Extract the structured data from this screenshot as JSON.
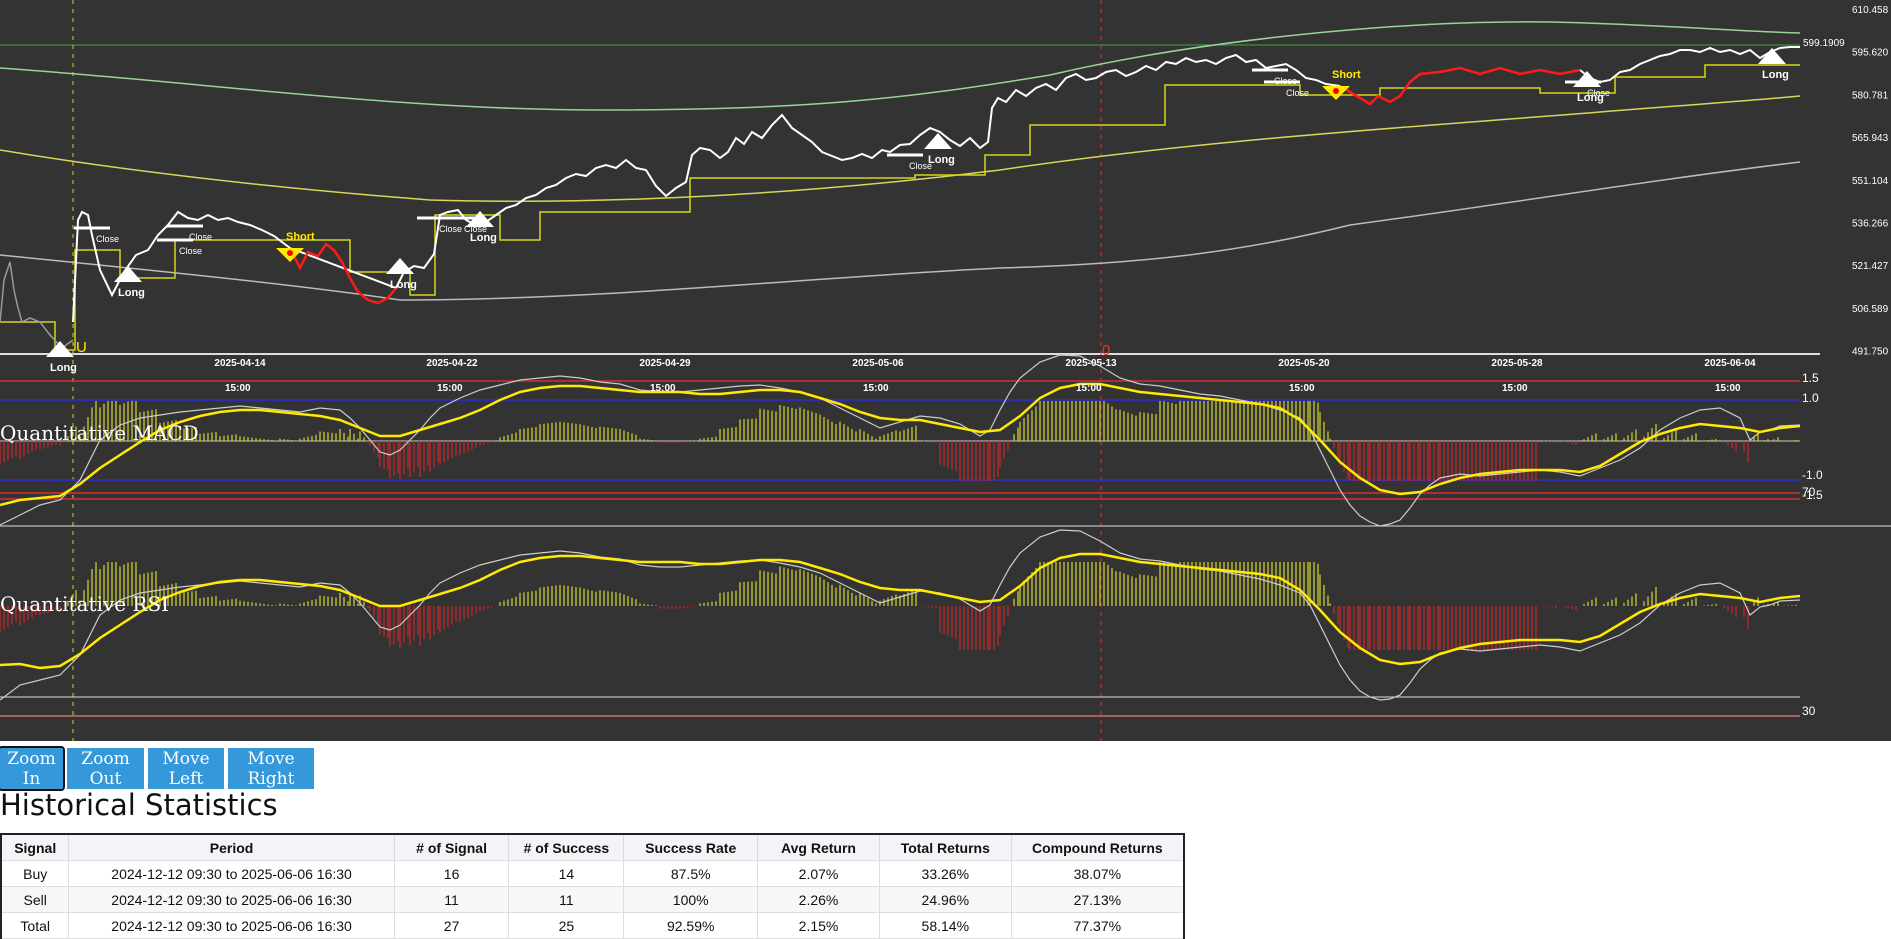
{
  "chart": {
    "background": "#333333",
    "colors": {
      "price": "#ffffff",
      "short_price": "#ff0000",
      "stop_line": "#d6d61a",
      "upper_band": "#9ad39a",
      "mid_band": "#d9d65a",
      "lower_band": "#bbbbbb",
      "signal_line": "#ffea00",
      "macd_line": "#cccccc",
      "hist_pos": "#c8c830",
      "hist_neg": "#c0282b",
      "level_red": "#d62e2e",
      "level_blue": "#2a2ad6",
      "cursor": "#ff2a2a",
      "cursor_yellow": "#d6d61a"
    },
    "price_axis": [
      "610.458",
      "595.620",
      "580.781",
      "565.943",
      "551.104",
      "536.266",
      "521.427",
      "506.589",
      "491.750"
    ],
    "price_marker": "599.1909",
    "date_labels": [
      "2025-04-14",
      "2025-04-22",
      "2025-04-29",
      "2025-05-06",
      "2025-05-13",
      "2025-05-20",
      "2025-05-28",
      "2025-06-04"
    ],
    "time_labels": [
      "15:00",
      "15:00",
      "15:00",
      "15:00",
      "15:00",
      "15:00",
      "15:00",
      "15:00"
    ],
    "cursor_labels": {
      "left": "U",
      "right": "0"
    },
    "macd": {
      "title": "Quantitative MACD",
      "levels": [
        "1.5",
        "1.0",
        "-1.0",
        "-1.5"
      ]
    },
    "rsi": {
      "title": "Quantitative RSI",
      "levels": [
        "70",
        "30"
      ]
    },
    "signals": [
      {
        "label": "Long",
        "type": "long"
      },
      {
        "label": "Close",
        "type": "close"
      },
      {
        "label": "Long",
        "type": "long"
      },
      {
        "label": "Close",
        "type": "close"
      },
      {
        "label": "Short",
        "type": "short"
      },
      {
        "label": "Close",
        "type": "close"
      },
      {
        "label": "Long",
        "type": "long"
      },
      {
        "label": "Close",
        "type": "close"
      },
      {
        "label": "Long",
        "type": "long"
      },
      {
        "label": "Close",
        "type": "close"
      },
      {
        "label": "Long",
        "type": "long"
      },
      {
        "label": "Close",
        "type": "close"
      },
      {
        "label": "Short",
        "type": "short"
      },
      {
        "label": "Close",
        "type": "close"
      },
      {
        "label": "Close",
        "type": "close"
      },
      {
        "label": "Long",
        "type": "long"
      },
      {
        "label": "Close",
        "type": "close"
      },
      {
        "label": "Long",
        "type": "long"
      }
    ]
  },
  "controls": {
    "zoom_in": "Zoom In",
    "zoom_out": "Zoom Out",
    "move_left": "Move Left",
    "move_right": "Move Right"
  },
  "stats": {
    "title": "Historical Statistics",
    "headers": [
      "Signal",
      "Period",
      "# of Signal",
      "# of Success",
      "Success Rate",
      "Avg Return",
      "Total Returns",
      "Compound Returns"
    ],
    "rows": [
      [
        "Buy",
        "2024-12-12 09:30 to 2025-06-06 16:30",
        "16",
        "14",
        "87.5%",
        "2.07%",
        "33.26%",
        "38.07%"
      ],
      [
        "Sell",
        "2024-12-12 09:30 to 2025-06-06 16:30",
        "11",
        "11",
        "100%",
        "2.26%",
        "24.96%",
        "27.13%"
      ],
      [
        "Total",
        "2024-12-12 09:30 to 2025-06-06 16:30",
        "27",
        "25",
        "92.59%",
        "2.15%",
        "58.14%",
        "77.37%"
      ]
    ]
  }
}
